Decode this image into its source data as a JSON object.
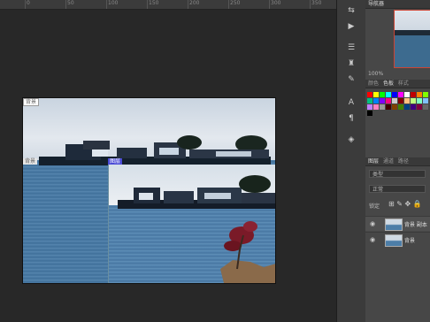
{
  "ruler": {
    "labels": [
      "0",
      "50",
      "100",
      "150",
      "200",
      "250",
      "300",
      "350"
    ]
  },
  "canvas": {
    "labels": {
      "layer1": "背景",
      "layer2": "背景",
      "layer3": "图层"
    }
  },
  "panels": {
    "navigator_tabs": [
      "导航器"
    ],
    "zoom": "100%",
    "swatch_tabs": [
      "颜色",
      "色板",
      "样式"
    ],
    "layers_tabs": [
      "图层",
      "通道",
      "路径"
    ],
    "kind_field": "类型",
    "blend_field": "正常",
    "lock_label": "锁定",
    "layers": [
      {
        "name": "背景 副本",
        "visible": true
      },
      {
        "name": "背景",
        "visible": true
      }
    ],
    "swatch_colors": [
      "#ff0000",
      "#ffff00",
      "#00ff00",
      "#00ffff",
      "#0000ff",
      "#ff00ff",
      "#ffffff",
      "#c00000",
      "#ff8000",
      "#80ff00",
      "#00c080",
      "#0080ff",
      "#8000ff",
      "#ff0080",
      "#cccccc",
      "#800000",
      "#ffc080",
      "#c0ff80",
      "#80ffc0",
      "#80c0ff",
      "#c080ff",
      "#ff80c0",
      "#999999",
      "#400000",
      "#804000",
      "#408000",
      "#004080",
      "#400080",
      "#800040",
      "#666666",
      "#000000"
    ]
  },
  "tools": {
    "icons": [
      "move-icon",
      "play-icon",
      "adjust-icon",
      "stamp-icon",
      "brush-icon",
      "type-icon",
      "pointer-icon",
      "layers-icon"
    ]
  }
}
